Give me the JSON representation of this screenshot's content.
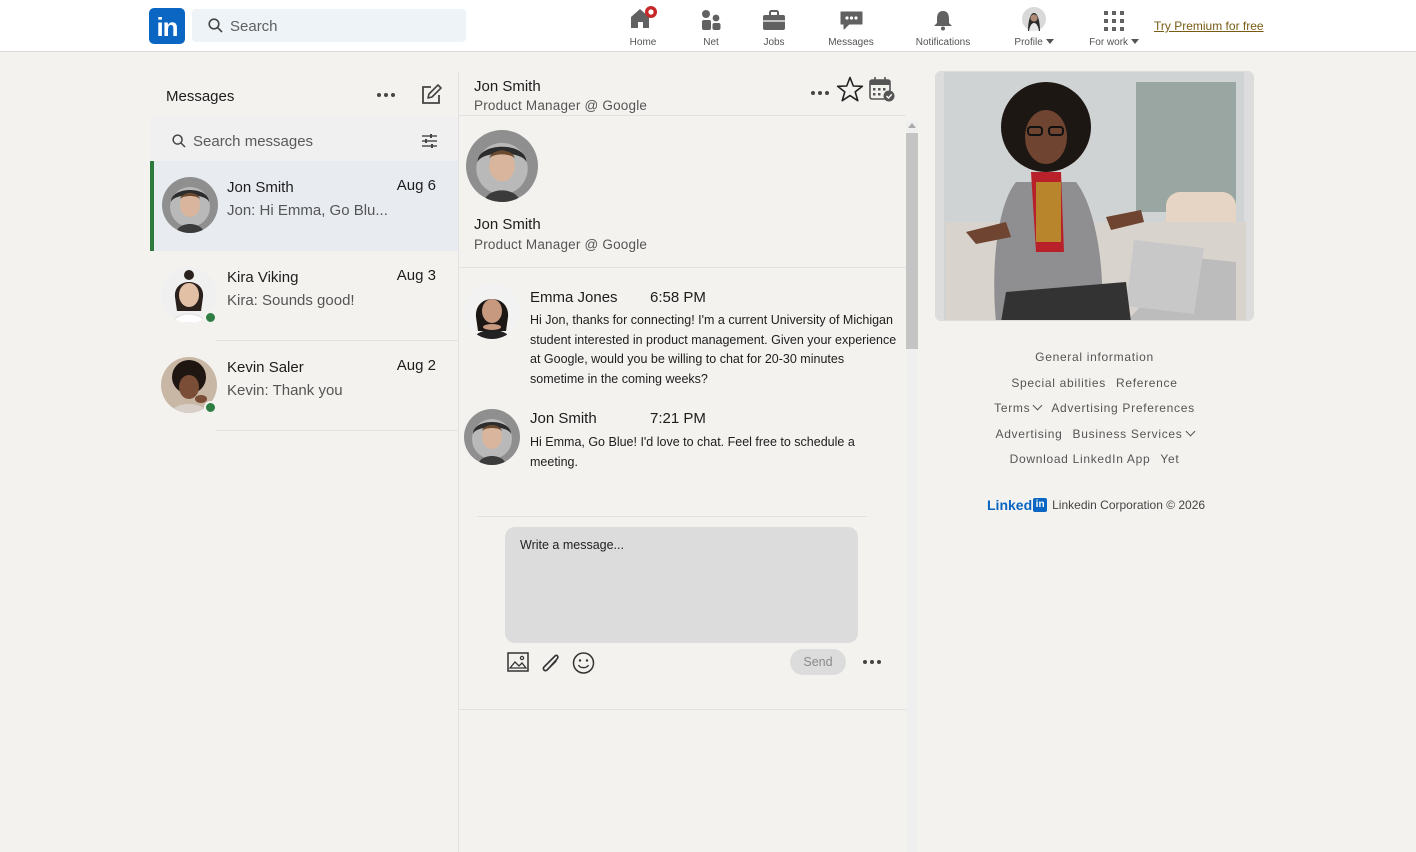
{
  "nav": {
    "logo_text": "in",
    "search_placeholder": "Search",
    "items": [
      {
        "label": "Home"
      },
      {
        "label": "Net"
      },
      {
        "label": "Jobs"
      },
      {
        "label": "Messages"
      },
      {
        "label": "Notifications"
      },
      {
        "label": "Profile"
      },
      {
        "label": "For work"
      }
    ],
    "premium_link": "Try Premium for free",
    "accent_color": "#0a66c2",
    "notification_dot_color": "#c62828"
  },
  "messaging": {
    "title": "Messages",
    "search_placeholder": "Search messages",
    "conversations": [
      {
        "name": "Jon Smith",
        "date": "Aug 6",
        "preview": "Jon:  Hi Emma, Go Blu...",
        "active": true,
        "online": false
      },
      {
        "name": "Kira Viking",
        "date": "Aug 3",
        "preview": "Kira:  Sounds good!",
        "active": false,
        "online": true
      },
      {
        "name": "Kevin Saler",
        "date": "Aug 2",
        "preview": "Kevin:  Thank you",
        "active": false,
        "online": true
      }
    ]
  },
  "thread": {
    "contact_name": "Jon Smith",
    "contact_title": "Product Manager @ Google",
    "messages": [
      {
        "sender": "Emma Jones",
        "time": "6:58 PM",
        "text": "Hi Jon, thanks for connecting! I'm a current University of Michigan student interested in product management. Given your experience at Google, would you be willing to chat for 20-30 minutes sometime in the coming weeks?"
      },
      {
        "sender": "Jon Smith",
        "time": "7:21 PM",
        "text": "Hi Emma, Go Blue! I'd love to chat. Feel free to schedule a meeting."
      }
    ],
    "compose_placeholder": "Write a message...",
    "send_label": "Send"
  },
  "footer": {
    "links": {
      "general": "General information",
      "special": "Special abilities",
      "reference": "Reference",
      "terms": "Terms",
      "ad_prefs": "Advertising Preferences",
      "advertising": "Advertising",
      "business": "Business Services",
      "download": "Download LinkedIn App",
      "yet": "Yet"
    },
    "brand": "Linked",
    "brand_mini": "in",
    "copyright": "Linkedin Corporation © 2026"
  }
}
